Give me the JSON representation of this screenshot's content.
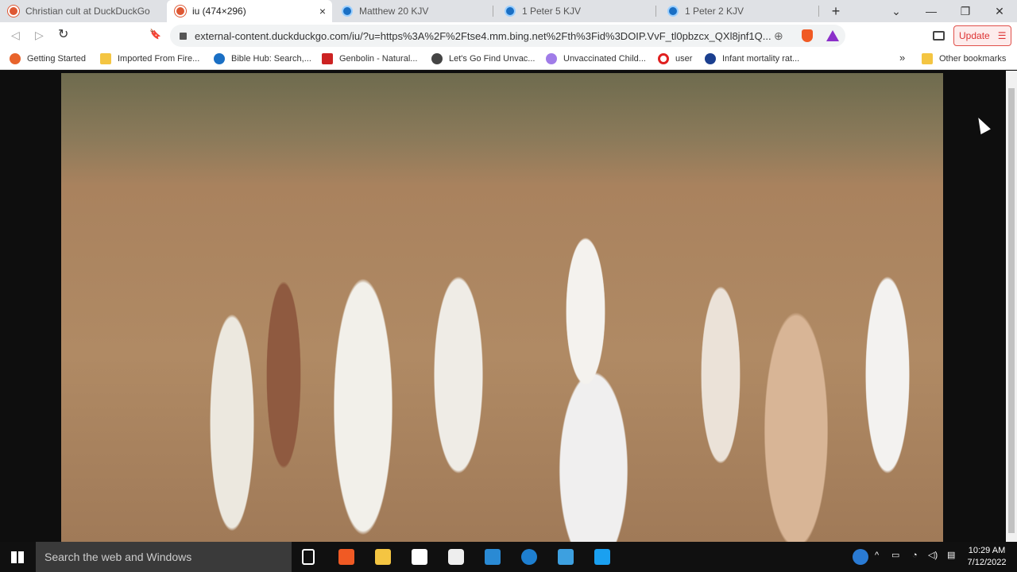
{
  "tabs": [
    {
      "title": "Christian cult at DuckDuckGo",
      "icon": "duckduckgo-icon",
      "active": false
    },
    {
      "title": "iu (474×296)",
      "icon": "duckduckgo-icon",
      "active": true
    },
    {
      "title": "Matthew 20 KJV",
      "icon": "biblehub-icon",
      "active": false
    },
    {
      "title": "1 Peter 5 KJV",
      "icon": "biblehub-icon",
      "active": false
    },
    {
      "title": "1 Peter 2 KJV",
      "icon": "biblehub-icon",
      "active": false
    }
  ],
  "tab_close": "×",
  "new_tab": "+",
  "window": {
    "list": "⌄",
    "minimize": "—",
    "restore": "❐",
    "close": "✕"
  },
  "toolbar": {
    "back": "◁",
    "forward": "▷",
    "reload": "↻",
    "bookmark": "🔖",
    "url": "external-content.duckduckgo.com/iu/?u=https%3A%2F%2Ftse4.mm.bing.net%2Fth%3Fid%3DOIP.VvF_tl0pbzcx_QXl8jnf1Q...",
    "zoom": "⊕",
    "update_label": "Update"
  },
  "bookmarks": [
    {
      "label": "Getting Started",
      "color": "#e8632b"
    },
    {
      "label": "Imported From Fire...",
      "color": "#f4c542"
    },
    {
      "label": "Bible Hub: Search,...",
      "color": "#1a6fc4"
    },
    {
      "label": "Genbolin - Natural...",
      "color": "#cc2222"
    },
    {
      "label": "Let's Go Find Unvac...",
      "color": "#444444"
    },
    {
      "label": "Unvaccinated Child...",
      "color": "#a07ce8"
    },
    {
      "label": "user",
      "color": "#e02020"
    },
    {
      "label": "Infant mortality rat...",
      "color": "#1b3f8f"
    }
  ],
  "bookmarks_more": "»",
  "other_bookmarks": "Other bookmarks",
  "taskbar": {
    "search_placeholder": "Search the web and Windows",
    "time": "10:29 AM",
    "date": "7/12/2022"
  },
  "colors": {
    "accent": "#e0504a",
    "tabbar": "#dfe1e5"
  }
}
